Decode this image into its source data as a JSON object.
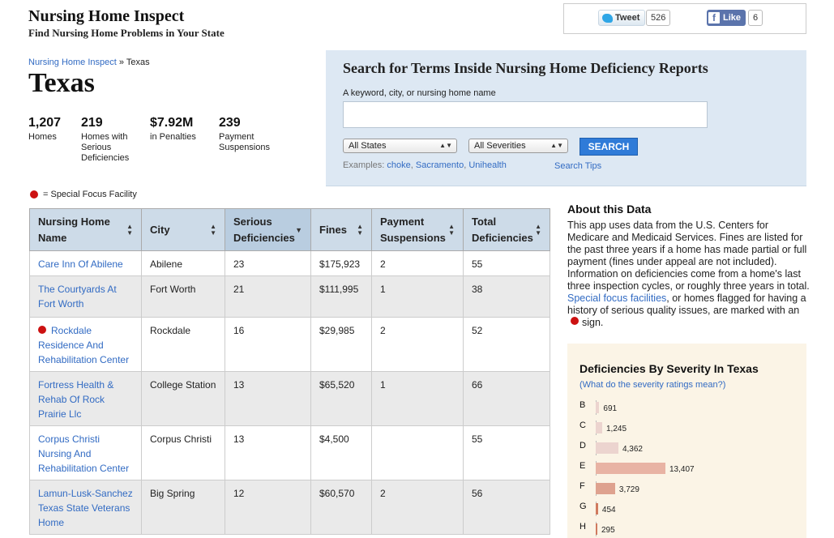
{
  "header": {
    "title": "Nursing Home Inspect",
    "tagline": "Find Nursing Home Problems in Your State"
  },
  "social": {
    "tweet_label": "Tweet",
    "tweet_count": "526",
    "like_label": "Like",
    "like_count": "6"
  },
  "breadcrumb": {
    "home": "Nursing Home Inspect",
    "sep": " » ",
    "current": "Texas"
  },
  "state": {
    "name": "Texas",
    "stats": [
      {
        "value": "1,207",
        "label": "Homes"
      },
      {
        "value": "219",
        "label": "Homes with Serious Deficiencies"
      },
      {
        "value": "$7.92M",
        "label": "in Penalties"
      },
      {
        "value": "239",
        "label": "Payment Suspensions"
      }
    ]
  },
  "legend": {
    "label": "= Special Focus Facility"
  },
  "search": {
    "heading": "Search for Terms Inside Nursing Home Deficiency Reports",
    "input_label": "A keyword, city, or nursing home name",
    "input_value": "",
    "states_select": "All States",
    "severities_select": "All Severities",
    "button": "SEARCH",
    "examples_prefix": "Examples: ",
    "examples": [
      "choke",
      "Sacramento",
      "Unihealth"
    ],
    "tips": "Search Tips"
  },
  "table": {
    "columns": [
      {
        "label": "Nursing Home Name",
        "sorted": false
      },
      {
        "label": "City",
        "sorted": false
      },
      {
        "label": "Serious Deficiencies",
        "sorted": true
      },
      {
        "label": "Fines",
        "sorted": false
      },
      {
        "label": "Payment Suspensions",
        "sorted": false
      },
      {
        "label": "Total Deficiencies",
        "sorted": false
      }
    ],
    "rows": [
      {
        "name": "Care Inn Of Abilene",
        "special_focus": false,
        "city": "Abilene",
        "serious": "23",
        "fines": "$175,923",
        "suspensions": "2",
        "total": "55"
      },
      {
        "name": "The Courtyards At Fort Worth",
        "special_focus": false,
        "city": "Fort Worth",
        "serious": "21",
        "fines": "$111,995",
        "suspensions": "1",
        "total": "38"
      },
      {
        "name": "Rockdale Residence And Rehabilitation Center",
        "special_focus": true,
        "city": "Rockdale",
        "serious": "16",
        "fines": "$29,985",
        "suspensions": "2",
        "total": "52"
      },
      {
        "name": "Fortress Health & Rehab Of Rock Prairie Llc",
        "special_focus": false,
        "city": "College Station",
        "serious": "13",
        "fines": "$65,520",
        "suspensions": "1",
        "total": "66"
      },
      {
        "name": "Corpus Christi Nursing And Rehabilitation Center",
        "special_focus": false,
        "city": "Corpus Christi",
        "serious": "13",
        "fines": "$4,500",
        "suspensions": "",
        "total": "55"
      },
      {
        "name": "Lamun-Lusk-Sanchez Texas State Veterans Home",
        "special_focus": false,
        "city": "Big Spring",
        "serious": "12",
        "fines": "$60,570",
        "suspensions": "2",
        "total": "56"
      }
    ]
  },
  "about": {
    "heading": "About this Data",
    "text_1": "This app uses data from the U.S. Centers for Medicare and Medicaid Services. Fines are listed for the past three years if a home has made partial or full payment (fines under appeal are not included). Information on deficiencies come from a home's last three inspection cycles, or roughly three years in total.",
    "link": "Special focus facilities",
    "text_2": ", or homes flagged for having a history of serious quality issues, are marked with an",
    "text_3": "sign."
  },
  "severity": {
    "title": "Deficiencies By Severity In Texas",
    "link": "(What do the severity ratings mean?)",
    "bar_color": "#ecd4cf",
    "highlight_colors": {
      "E": "#e8b3a4",
      "F": "#dea28f",
      "G": "#d07a5f",
      "H": "#d07a5f"
    }
  },
  "chart_data": {
    "type": "bar",
    "title": "Deficiencies By Severity In Texas",
    "categories": [
      "B",
      "C",
      "D",
      "E",
      "F",
      "G",
      "H"
    ],
    "values": [
      691,
      1245,
      4362,
      13407,
      3729,
      454,
      295
    ],
    "labels": [
      "691",
      "1,245",
      "4,362",
      "13,407",
      "3,729",
      "454",
      "295"
    ]
  }
}
